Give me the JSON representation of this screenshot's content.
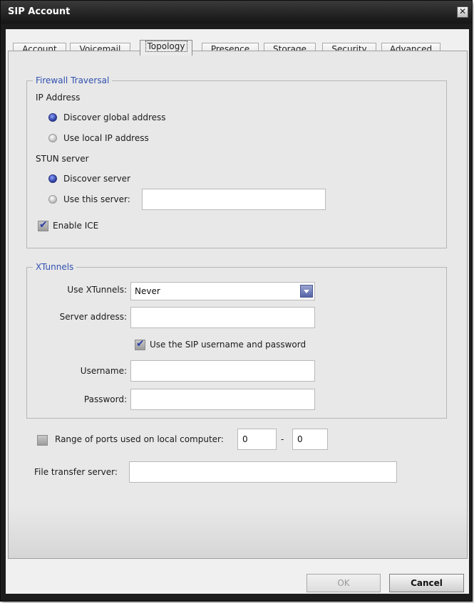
{
  "window": {
    "title": "SIP Account",
    "close_glyph": "✕"
  },
  "tabs": [
    {
      "label": "Account"
    },
    {
      "label": "Voicemail"
    },
    {
      "label": "Topology"
    },
    {
      "label": "Presence"
    },
    {
      "label": "Storage"
    },
    {
      "label": "Security"
    },
    {
      "label": "Advanced"
    }
  ],
  "active_tab": "Topology",
  "firewall": {
    "legend": "Firewall Traversal",
    "ip_address_label": "IP Address",
    "discover_global": "Discover global address",
    "use_local_ip": "Use local IP address",
    "ip_selected": "discover_global",
    "stun_label": "STUN server",
    "discover_server": "Discover server",
    "use_this_server": "Use this server:",
    "stun_selected": "discover_server",
    "stun_server_value": "",
    "enable_ice": "Enable ICE",
    "enable_ice_checked": true
  },
  "xtunnels": {
    "legend": "XTunnels",
    "use_label": "Use XTunnels:",
    "use_value": "Never",
    "server_address_label": "Server address:",
    "server_address_value": "",
    "use_sip_credentials": "Use the SIP username and password",
    "use_sip_credentials_checked": true,
    "username_label": "Username:",
    "username_value": "",
    "password_label": "Password:",
    "password_value": ""
  },
  "ports": {
    "label": "Range of ports used on local computer:",
    "checked": false,
    "from": "0",
    "separator": "-",
    "to": "0"
  },
  "file_transfer": {
    "label": "File transfer server:",
    "value": ""
  },
  "buttons": {
    "ok": "OK",
    "cancel": "Cancel"
  },
  "icons": {
    "check_mark": "✔"
  },
  "colors": {
    "accent": "#3050b0",
    "titlebar": "#1c1c1c"
  }
}
